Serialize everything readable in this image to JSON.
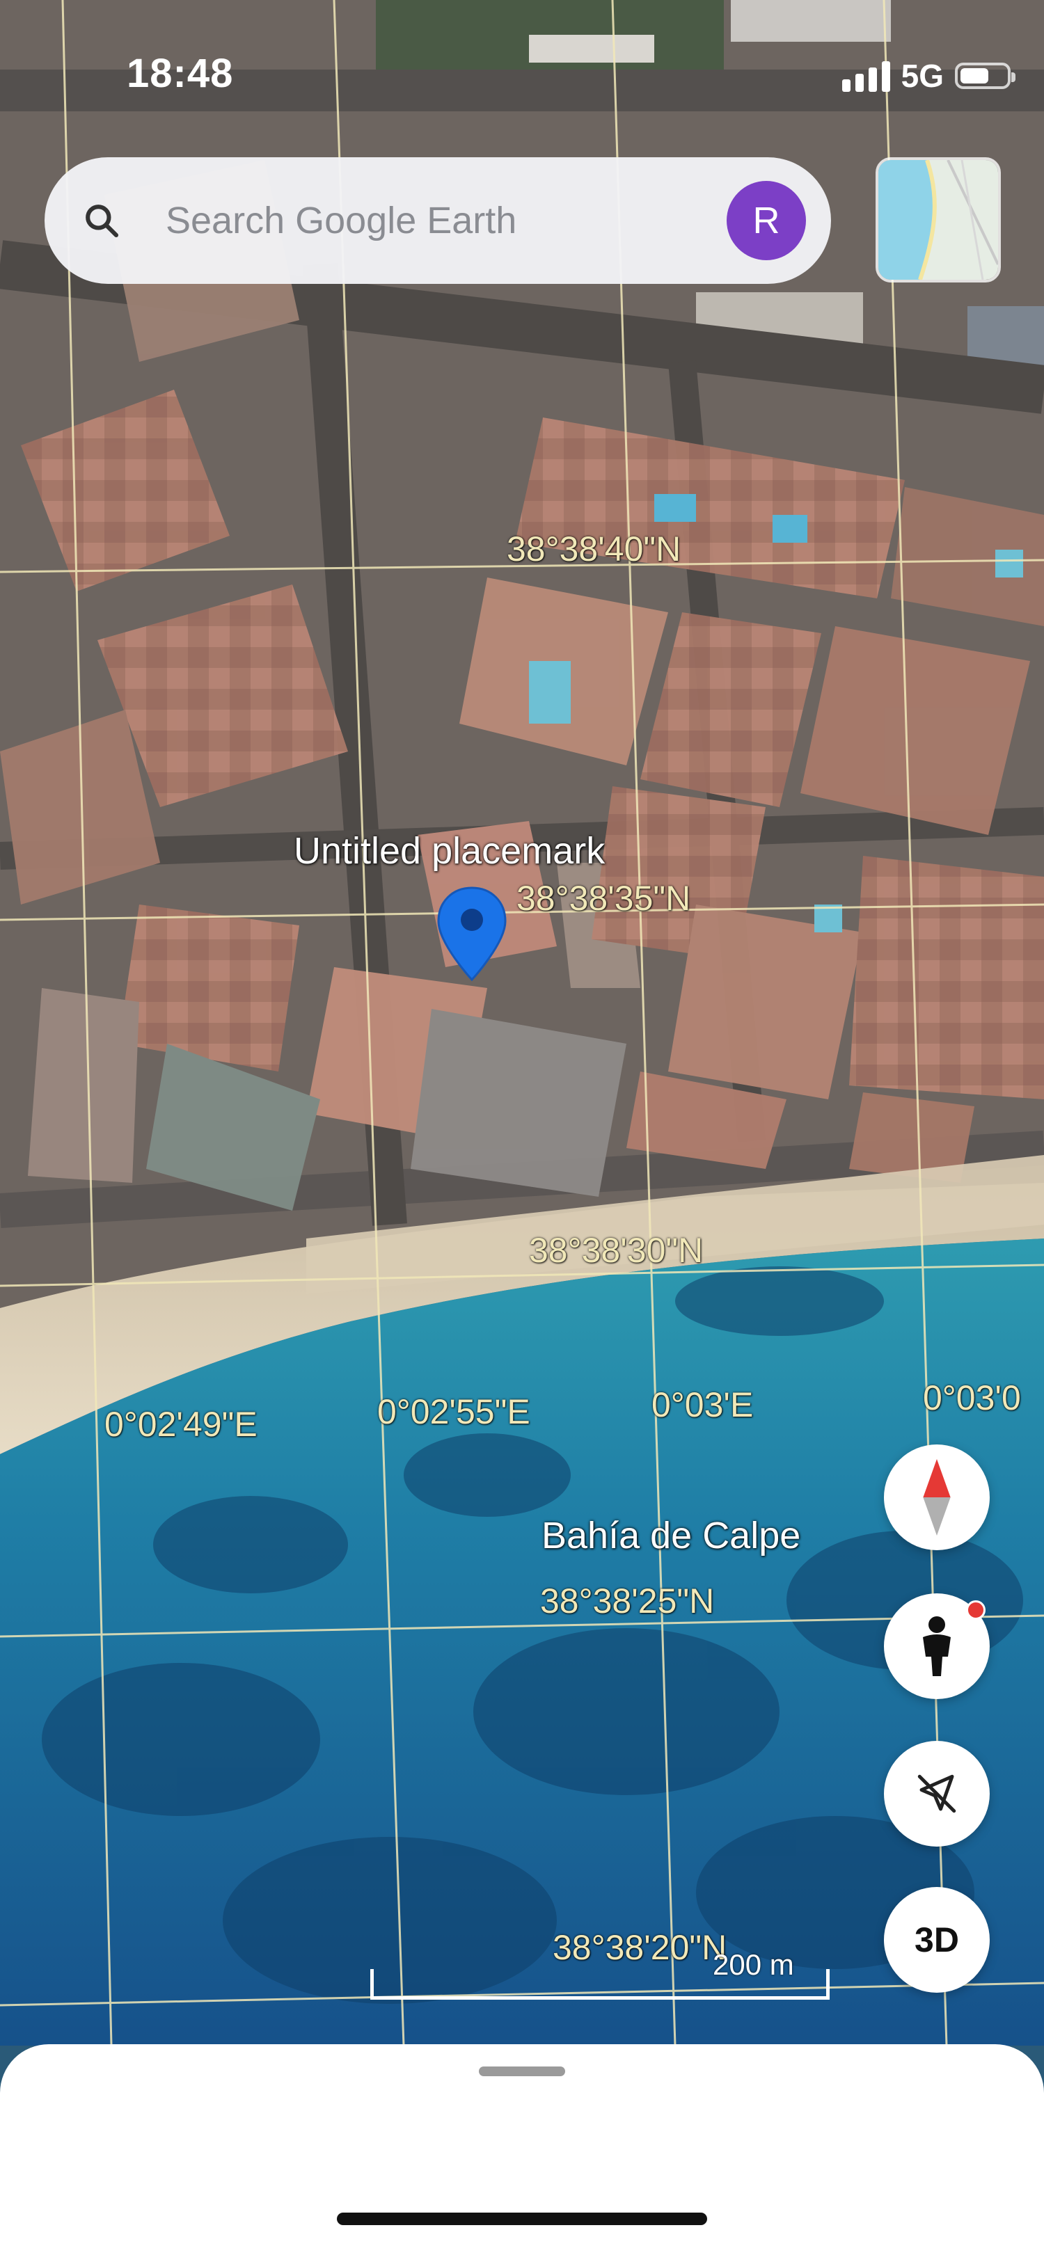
{
  "status_bar": {
    "time": "18:48",
    "network": "5G",
    "signal_bars": 4,
    "battery_level": 0.5
  },
  "search": {
    "placeholder": "Search Google Earth",
    "avatar_initial": "R",
    "avatar_color": "#7c3fc6"
  },
  "map": {
    "placemark_label": "Untitled placemark",
    "pin_color": "#1a73e8",
    "place_name": "Bahía de Calpe",
    "latitude_labels": [
      "38°38'40\"N",
      "38°38'35\"N",
      "38°38'30\"N",
      "38°38'25\"N",
      "38°38'20\"N"
    ],
    "longitude_labels": [
      "0°02'49\"E",
      "0°02'55\"E",
      "0°03'E",
      "0°03'0"
    ],
    "scale_label": "200 m",
    "grid_color": "#f1e8b8"
  },
  "controls": {
    "compass_icon": "compass-icon",
    "street_view_icon": "pegman-icon",
    "location_icon": "location-off-icon",
    "view_3d_label": "3D"
  }
}
